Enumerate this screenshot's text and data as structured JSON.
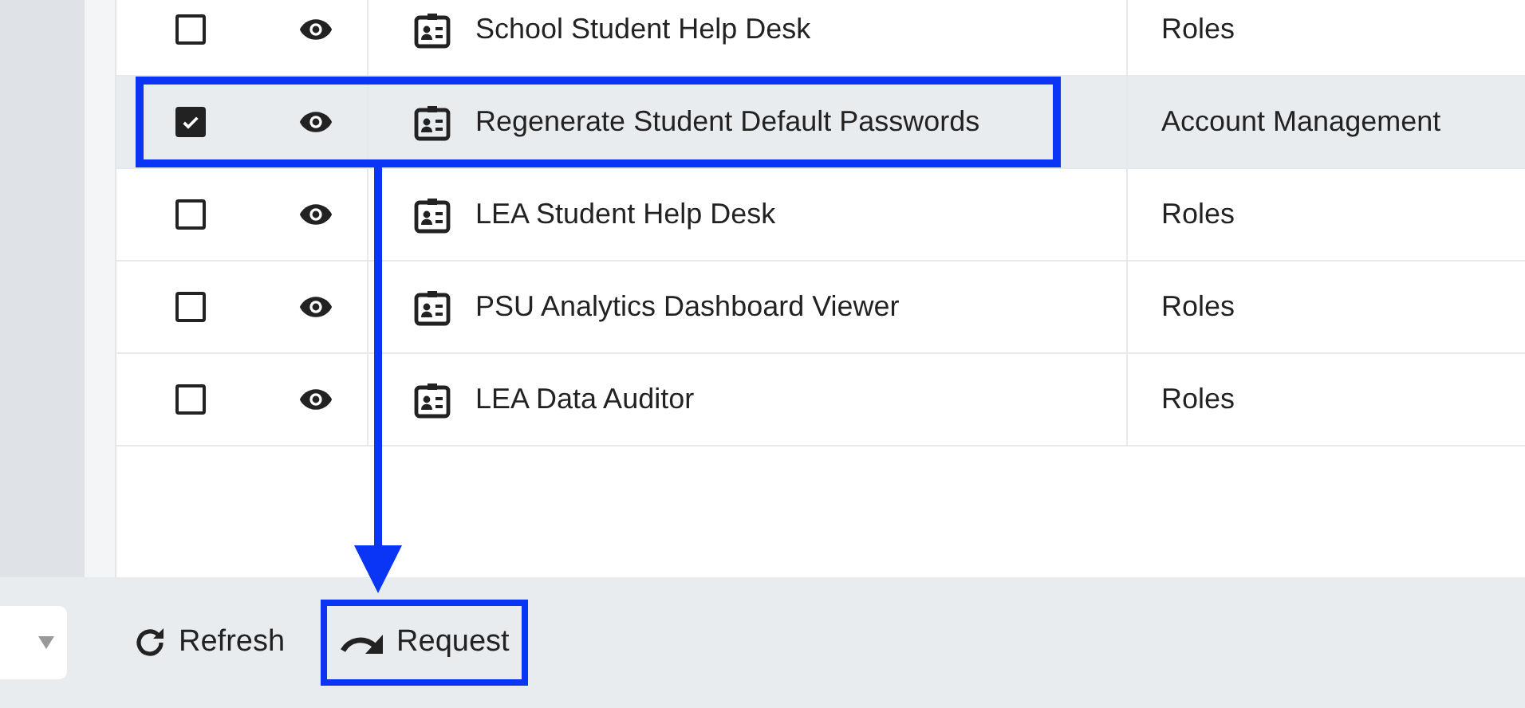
{
  "table": {
    "rows": [
      {
        "checked": false,
        "name": "School Student Help Desk",
        "category": "Roles",
        "highlighted": false
      },
      {
        "checked": true,
        "name": "Regenerate Student Default Passwords",
        "category": "Account Management",
        "highlighted": true
      },
      {
        "checked": false,
        "name": "LEA Student Help Desk",
        "category": "Roles",
        "highlighted": false
      },
      {
        "checked": false,
        "name": "PSU Analytics Dashboard Viewer",
        "category": "Roles",
        "highlighted": false
      },
      {
        "checked": false,
        "name": "LEA Data Auditor",
        "category": "Roles",
        "highlighted": false
      }
    ]
  },
  "toolbar": {
    "buttons": [
      {
        "kind": "refresh",
        "label": "Refresh",
        "highlighted": false
      },
      {
        "kind": "request",
        "label": "Request",
        "highlighted": true
      }
    ]
  }
}
